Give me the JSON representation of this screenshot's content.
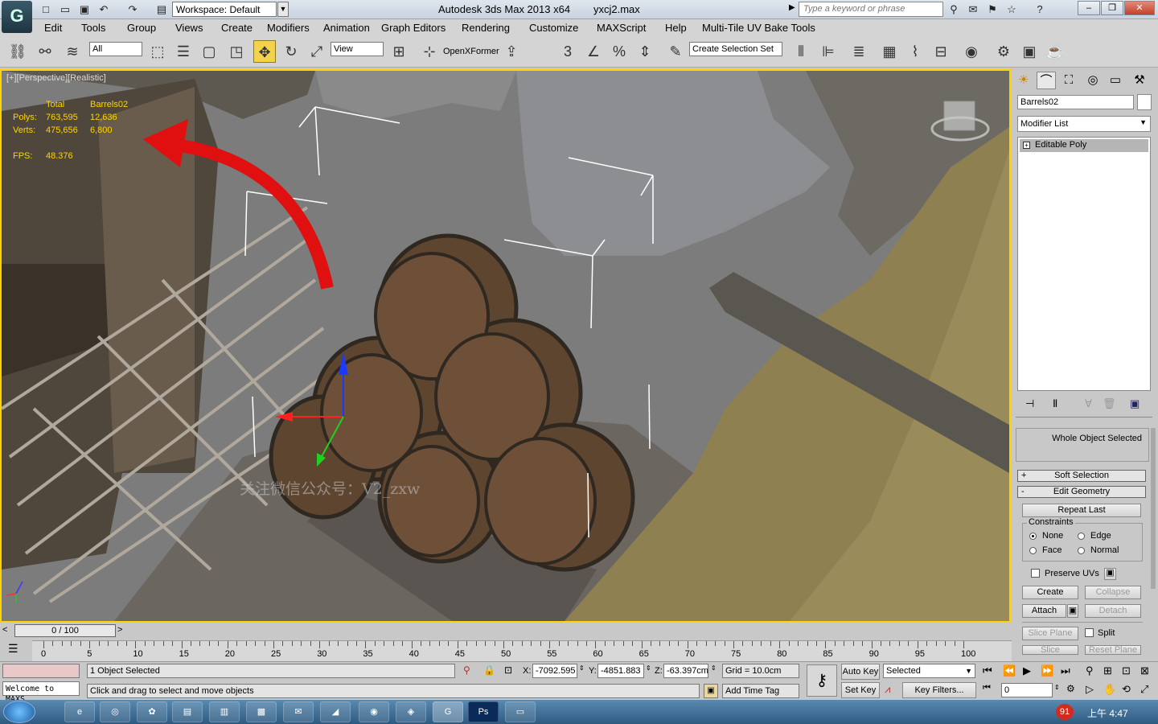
{
  "titlebar": {
    "workspace": "Workspace: Default",
    "app_title": "Autodesk 3ds Max  2013 x64",
    "filename": "yxcj2.max",
    "search_placeholder": "Type a keyword or phrase"
  },
  "menu": [
    "Edit",
    "Tools",
    "Group",
    "Views",
    "Create",
    "Modifiers",
    "Animation",
    "Graph Editors",
    "Rendering",
    "Customize",
    "MAXScript",
    "Help",
    "Multi-Tile UV Bake Tools"
  ],
  "toolbar": {
    "filter": "All",
    "refcoord": "View",
    "openxformer": "OpenXFormer",
    "selection_set": "Create Selection Set"
  },
  "viewport": {
    "label": "[+][Perspective][Realistic]",
    "stats": {
      "h_total": "Total",
      "h_obj": "Barrels02",
      "polys_label": "Polys:",
      "polys_total": "763,595",
      "polys_obj": "12,636",
      "verts_label": "Verts:",
      "verts_total": "475,656",
      "verts_obj": "6,800",
      "fps_label": "FPS:",
      "fps": "48.376"
    },
    "watermark": "关注微信公众号：V2_zxw"
  },
  "cmdpanel": {
    "object_name": "Barrels02",
    "modifier_list": "Modifier List",
    "stack_item": "Editable Poly",
    "whole_object": "Whole Object Selected",
    "soft_selection": "Soft Selection",
    "edit_geometry": "Edit Geometry",
    "repeat_last": "Repeat Last",
    "constraints": "Constraints",
    "none": "None",
    "edge": "Edge",
    "face": "Face",
    "normal": "Normal",
    "preserve_uvs": "Preserve UVs",
    "create": "Create",
    "collapse": "Collapse",
    "attach": "Attach",
    "detach": "Detach",
    "slice_plane": "Slice Plane",
    "split": "Split",
    "slice": "Slice",
    "reset_plane": "Reset Plane"
  },
  "timeline": {
    "slider": "0 / 100",
    "ticks": [
      "0",
      "5",
      "10",
      "15",
      "20",
      "25",
      "30",
      "35",
      "40",
      "45",
      "50",
      "55",
      "60",
      "65",
      "70",
      "75",
      "80",
      "85",
      "90",
      "95",
      "100"
    ]
  },
  "status": {
    "maxscript": "Welcome to MAXS",
    "selected": "1 Object Selected",
    "prompt": "Click and drag to select and move objects",
    "x_label": "X:",
    "x": "-7092.595",
    "y_label": "Y:",
    "y": "-4851.883",
    "z_label": "Z:",
    "z": "-63.397cm",
    "grid": "Grid = 10.0cm",
    "add_time_tag": "Add Time Tag",
    "auto_key": "Auto Key",
    "set_key": "Set Key",
    "key_mode": "Selected",
    "key_filters": "Key Filters...",
    "frame": "0"
  },
  "taskbar": {
    "clock": "上午 4:47",
    "badge": "91"
  }
}
